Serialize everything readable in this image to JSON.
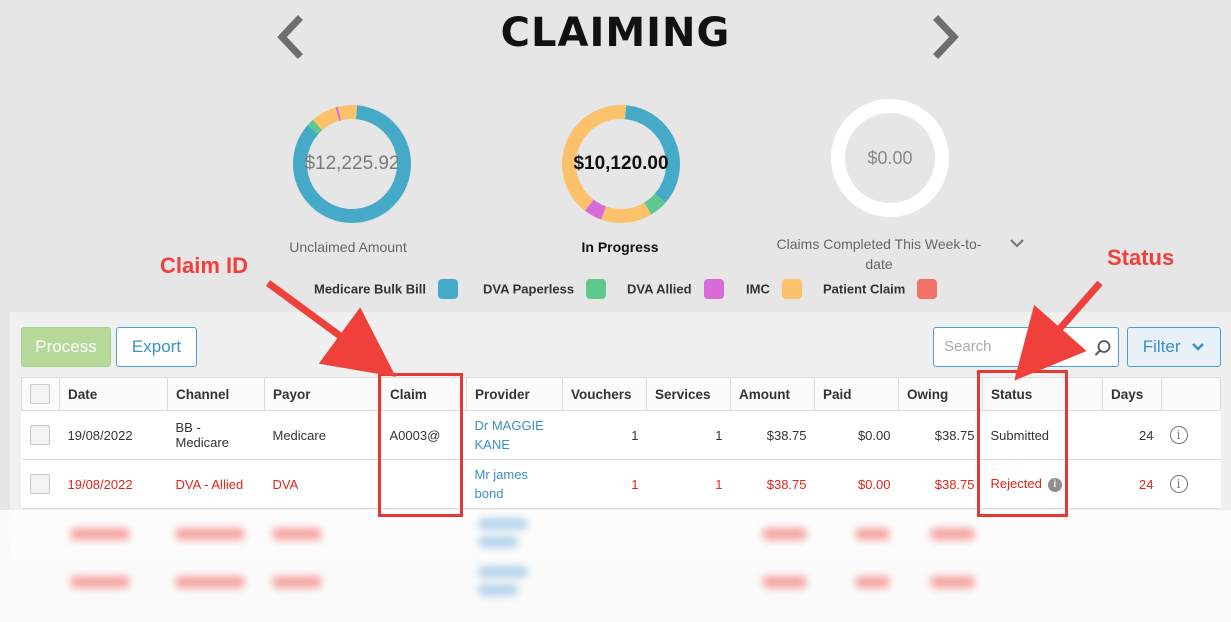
{
  "header": {
    "title": "CLAIMING",
    "prev_icon": "chevron-left-icon",
    "next_icon": "chevron-right-icon"
  },
  "summary": {
    "unclaimed": {
      "value": "$12,225.92",
      "caption": "Unclaimed Amount",
      "segments": [
        {
          "category": "Medicare Bulk Bill",
          "fraction": 0.85,
          "color": "#45aac8"
        },
        {
          "category": "DVA Paperless",
          "fraction": 0.02,
          "color": "#5ec98f"
        },
        {
          "category": "Patient Claim",
          "fraction": 0.07,
          "color": "#fbc16b"
        },
        {
          "category": "IMC",
          "fraction": 0.006,
          "color": "#d96ad9"
        },
        {
          "category": "Patient Claim",
          "fraction": 0.054,
          "color": "#fbc16b"
        }
      ]
    },
    "in_progress": {
      "value": "$10,120.00",
      "caption": "In Progress",
      "segments": [
        {
          "category": "Medicare Bulk Bill",
          "fraction": 0.35,
          "color": "#45aac8"
        },
        {
          "category": "DVA Paperless",
          "fraction": 0.05,
          "color": "#5ec98f"
        },
        {
          "category": "Patient Claim",
          "fraction": 0.14,
          "color": "#fbc16b"
        },
        {
          "category": "IMC",
          "fraction": 0.05,
          "color": "#d96ad9"
        },
        {
          "category": "Patient Claim",
          "fraction": 0.41,
          "color": "#fbc16b"
        }
      ]
    },
    "completed": {
      "value": "$0.00",
      "caption_line1": "Claims Completed This Week-to-",
      "caption_line2": "date",
      "toggle_icon": "chevron-down-icon"
    }
  },
  "legend": [
    {
      "label": "Medicare Bulk Bill",
      "color": "#45aac8"
    },
    {
      "label": "DVA Paperless",
      "color": "#5ec98f"
    },
    {
      "label": "DVA Allied",
      "color": "#d96ad9"
    },
    {
      "label": "IMC",
      "color": "#fbc16b"
    },
    {
      "label": "Patient Claim",
      "color": "#f37268"
    }
  ],
  "toolbar": {
    "process_label": "Process",
    "export_label": "Export",
    "search_placeholder": "Search",
    "search_icon": "search-icon",
    "filter_label": "Filter",
    "filter_icon": "chevron-down-icon"
  },
  "table": {
    "headers": {
      "date": "Date",
      "channel": "Channel",
      "payor": "Payor",
      "claim": "Claim",
      "provider": "Provider",
      "vouchers": "Vouchers",
      "services": "Services",
      "amount": "Amount",
      "paid": "Paid",
      "owing": "Owing",
      "status": "Status",
      "days": "Days"
    },
    "rows": [
      {
        "date": "19/08/2022",
        "channel": "BB - Medicare",
        "payor": "Medicare",
        "claim": "A0003@",
        "provider_line1": "Dr MAGGIE",
        "provider_line2": "KANE",
        "vouchers": "1",
        "services": "1",
        "amount": "$38.75",
        "paid": "$0.00",
        "owing": "$38.75",
        "status": "Submitted",
        "days": "24"
      },
      {
        "date": "19/08/2022",
        "channel": "DVA - Allied",
        "payor": "DVA",
        "claim": "",
        "provider_line1": "Mr james",
        "provider_line2": "bond",
        "vouchers": "1",
        "services": "1",
        "amount": "$38.75",
        "paid": "$0.00",
        "owing": "$38.75",
        "status": "Rejected",
        "days": "24"
      }
    ]
  },
  "annotations": {
    "claim_id_label": "Claim ID",
    "status_label": "Status",
    "color": "#f0403c"
  }
}
